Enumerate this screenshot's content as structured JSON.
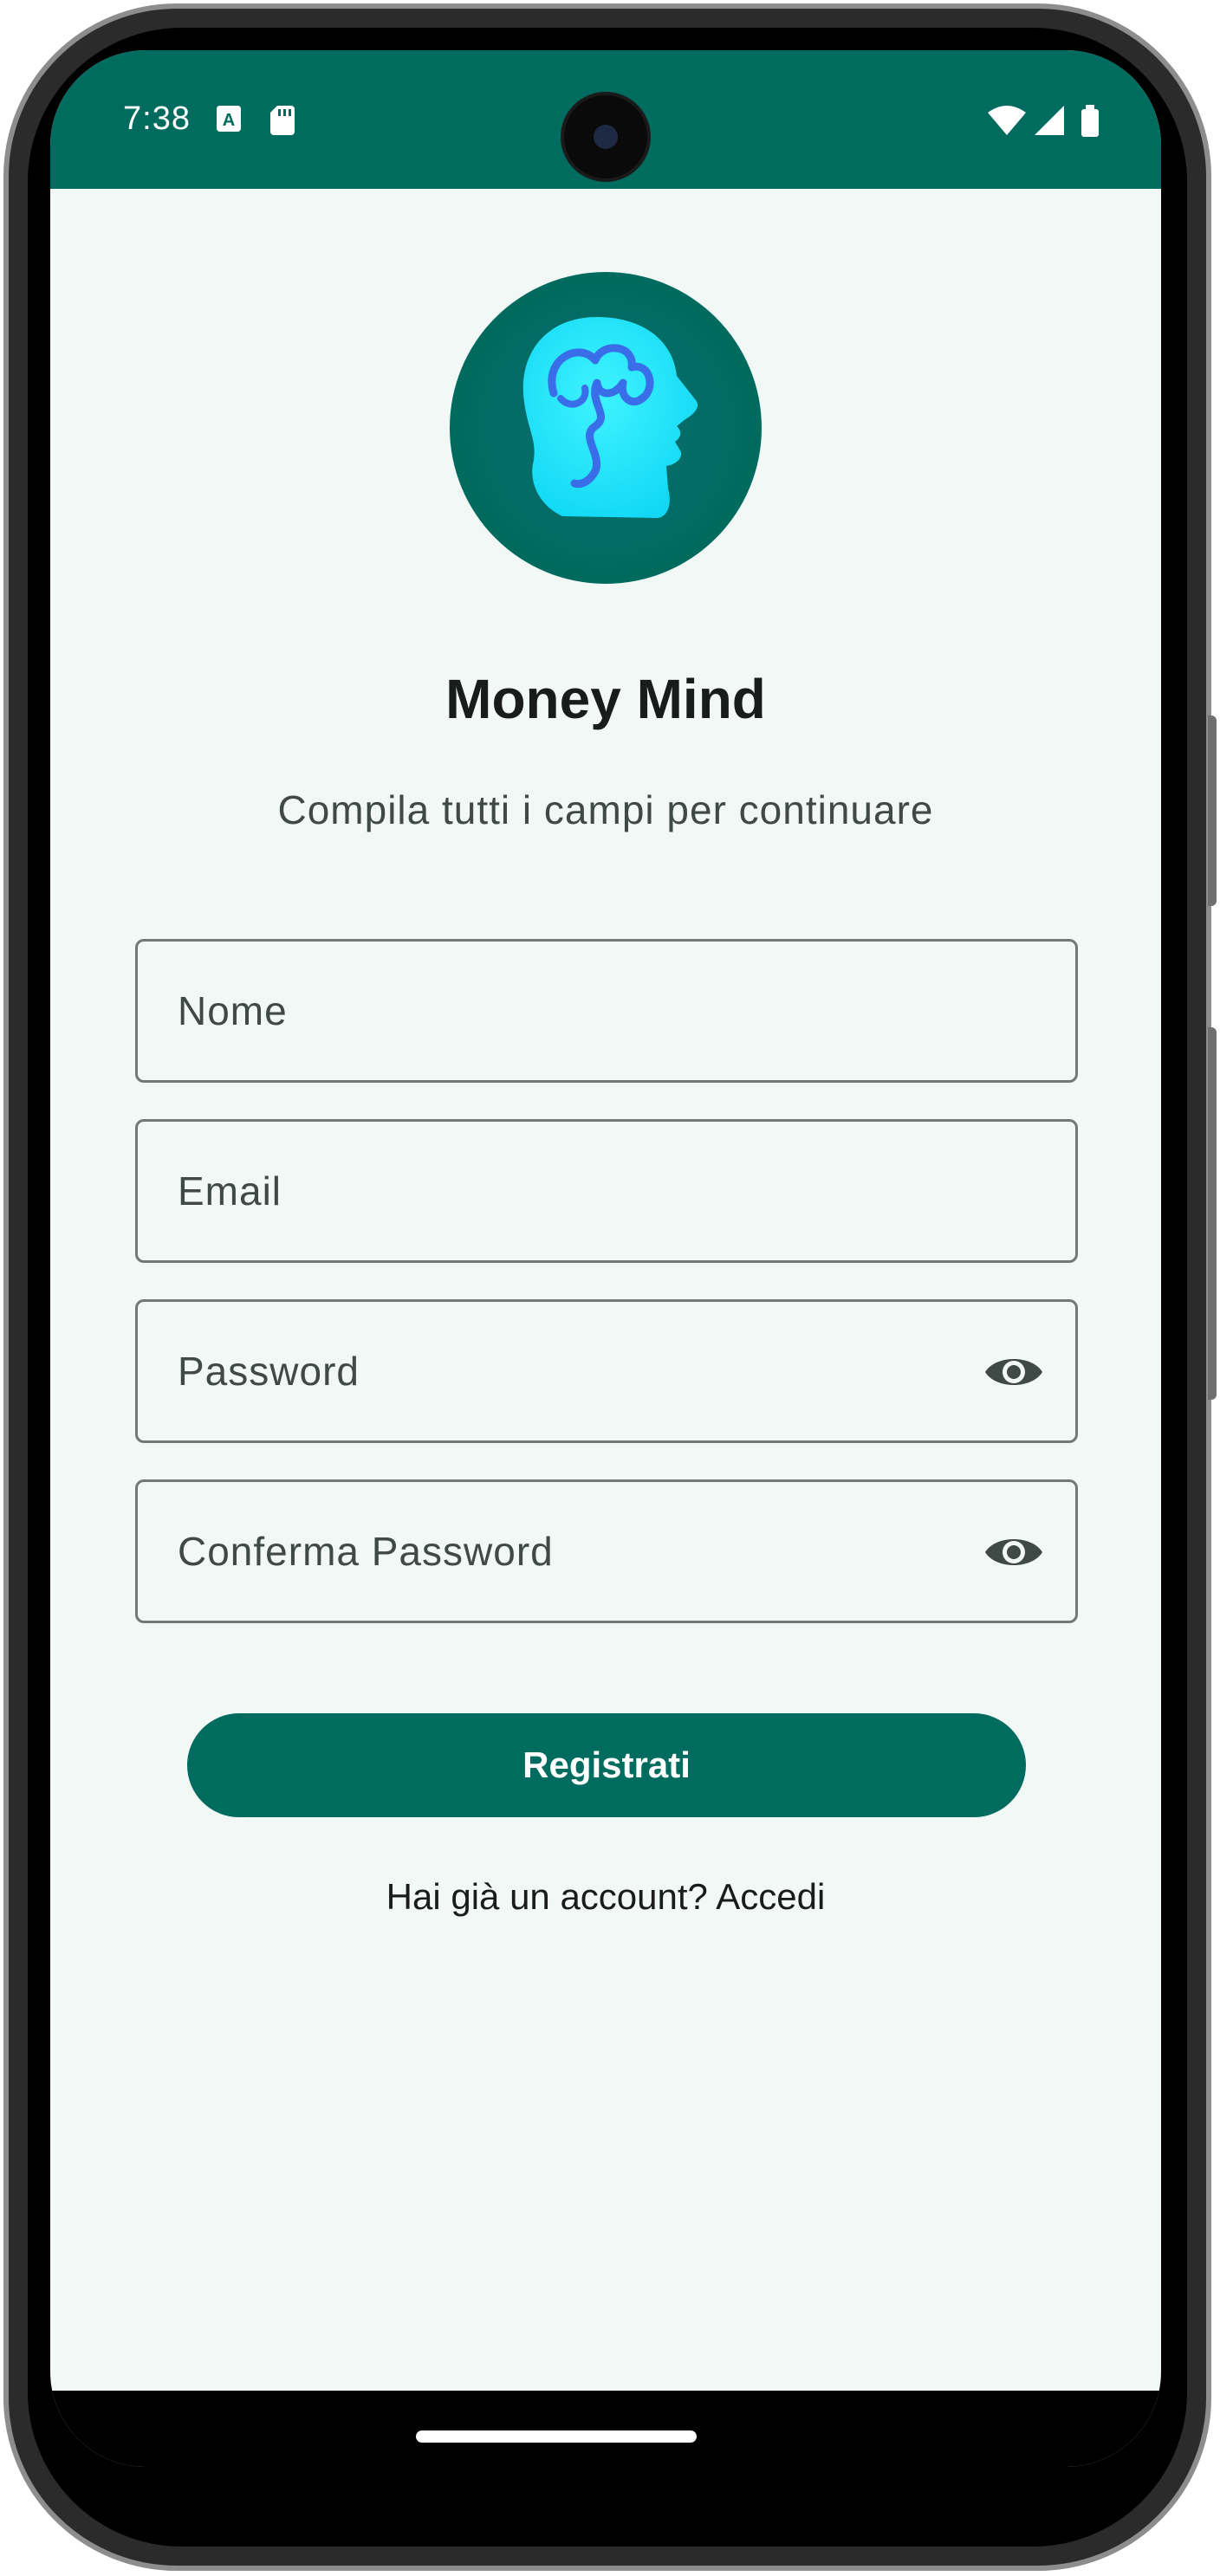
{
  "status_bar": {
    "time": "7:38",
    "color": "#006b5f",
    "icons": [
      "text-a-icon",
      "sd-card-icon",
      "wifi-icon",
      "signal-icon",
      "battery-icon"
    ]
  },
  "app": {
    "name": "Money Mind",
    "logo": "brain-head-icon",
    "accent": "#006b5f"
  },
  "form": {
    "subtitle": "Compila tutti i campi per continuare",
    "name_placeholder": "Nome",
    "email_placeholder": "Email",
    "password_placeholder": "Password",
    "confirm_password_placeholder": "Conferma Password",
    "visibility_icon": "eye-icon",
    "submit_label": "Registrati",
    "login_prompt": "Hai già un account? Accedi"
  }
}
